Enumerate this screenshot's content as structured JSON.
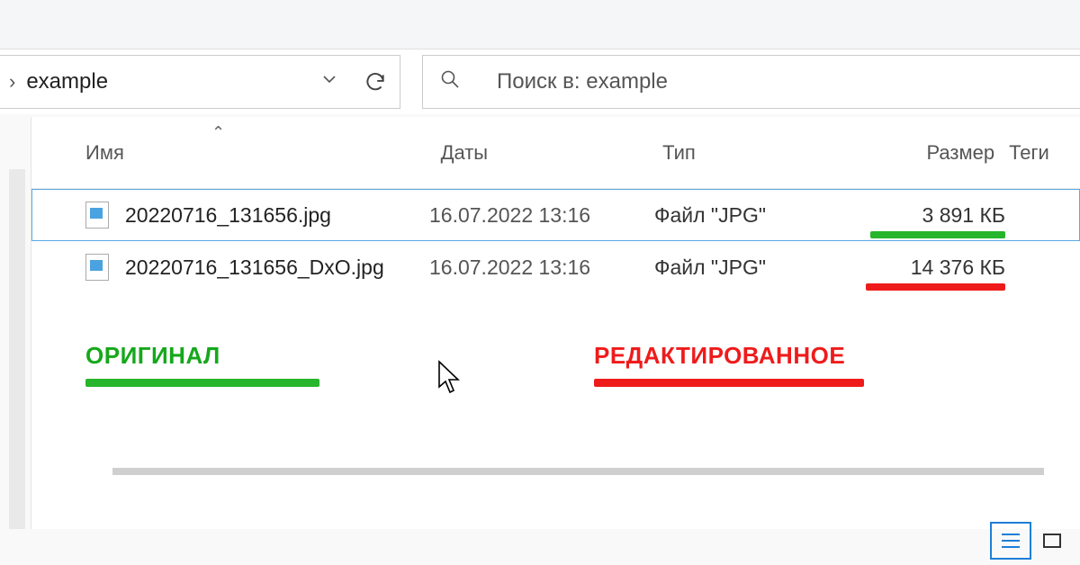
{
  "address": {
    "folder": "example"
  },
  "search": {
    "placeholder": "Поиск в: example"
  },
  "columns": {
    "name": "Имя",
    "date": "Даты",
    "type": "Тип",
    "size": "Размер",
    "tags": "Теги"
  },
  "files": [
    {
      "name": "20220716_131656.jpg",
      "date": "16.07.2022 13:16",
      "type": "Файл \"JPG\"",
      "size": "3 891 КБ",
      "highlight": "green",
      "selected": true
    },
    {
      "name": "20220716_131656_DxO.jpg",
      "date": "16.07.2022 13:16",
      "type": "Файл \"JPG\"",
      "size": "14 376 КБ",
      "highlight": "red",
      "selected": false
    }
  ],
  "annotations": {
    "original": "ОРИГИНАЛ",
    "edited": "РЕДАКТИРОВАННОЕ"
  }
}
